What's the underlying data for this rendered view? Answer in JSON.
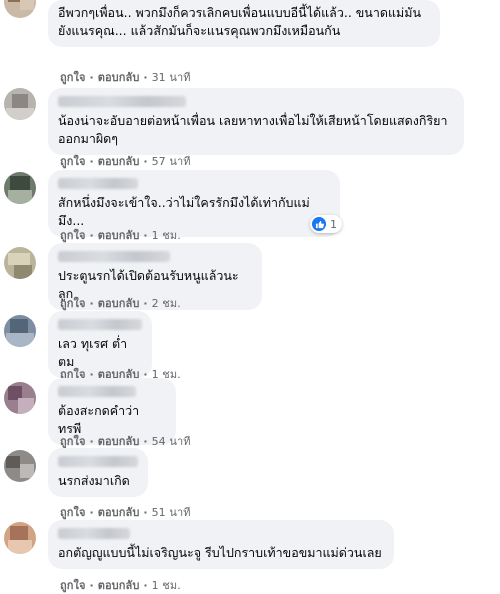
{
  "action_labels": {
    "like": "ถูกใจ",
    "reply": "ตอบกลับ",
    "separator": "·"
  },
  "comments": [
    {
      "text": "อีพวกๆเพื่อน.. พวกมึงก็ควรเลิกคบเพื่อนแบบอีนี้ได้แล้ว.. ขนาดแม่มันยังแนรคุณ... แล้วสักมันก็จะแนรคุณพวกมึงเหมือนกัน",
      "time": "31 นาที"
    },
    {
      "text": "น้องน่าจะอับอายต่อหน้าเพื่อน เลยหาทางเพื่อไม่ให้เสียหน้าโดยแสดงกิริยาออกมาผิดๆ",
      "time": "57 นาที"
    },
    {
      "text": "สักหนึ่งมึงจะเข้าใจ..ว่าไม่ใครรักมึงได้เท่ากับแม่มึง...",
      "time": "1 ชม.",
      "reaction_count": "1"
    },
    {
      "text": "ประตูนรกได้เปิดต้อนรับหนูแล้วนะลูก",
      "time": "2 ชม."
    },
    {
      "text": "เลว ทุเรศ ต่ำตม",
      "time": "1 ชม."
    },
    {
      "text": "ต้องสะกดคำว่า ทรพี",
      "time": "54 นาที"
    },
    {
      "text": "นรกส่งมาเกิด",
      "time": "51 นาที"
    },
    {
      "text": "อกตัญญูแบบนี้ไม่เจริญนะจู รีบไปกราบเท้าขอขมาแม่ด่วนเลย",
      "time": "1 ชม."
    }
  ],
  "colors": {
    "bubble": "#f0f2f5",
    "meta": "#65676b",
    "like_blue": "#1877f2"
  }
}
